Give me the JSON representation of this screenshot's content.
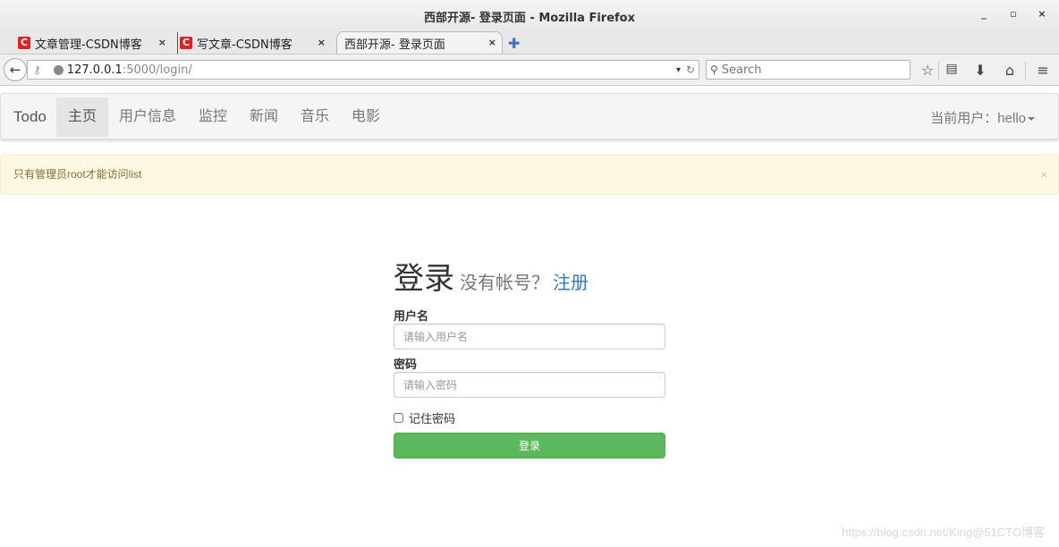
{
  "window": {
    "title": "西部开源- 登录页面 - Mozilla Firefox",
    "minimize": "_",
    "maximize": "▫",
    "close": "×"
  },
  "tabs": [
    {
      "label": "文章管理-CSDN博客",
      "favicon": "C",
      "close": "×"
    },
    {
      "label": "写文章-CSDN博客",
      "favicon": "C",
      "close": "×"
    },
    {
      "label": "西部开源- 登录页面",
      "close": "×",
      "active": true
    }
  ],
  "new_tab_icon": "✚",
  "toolbar": {
    "back_icon": "🡐",
    "url_host": "127.0.0.1",
    "url_rest": ":5000/login/",
    "search_placeholder": "Search",
    "icons": [
      "bookmark-star-icon",
      "reading-list-icon",
      "download-icon",
      "home-icon",
      "menu-icon"
    ]
  },
  "app": {
    "brand": "Todo",
    "nav": [
      {
        "label": "主页",
        "active": true
      },
      {
        "label": "用户信息"
      },
      {
        "label": "监控"
      },
      {
        "label": "新闻"
      },
      {
        "label": "音乐"
      },
      {
        "label": "电影"
      }
    ],
    "current_user": "当前用户：hello"
  },
  "alert": {
    "message": "只有管理员root才能访问list",
    "close": "×",
    "color": "#fcf8e3"
  },
  "login": {
    "title": "登录",
    "subtitle": "没有帐号？",
    "register_link": "注册",
    "username_label": "用户名",
    "username_placeholder": "请输入用户名",
    "password_label": "密码",
    "password_placeholder": "请输入密码",
    "remember_label": "记住密码",
    "remember_checked": false,
    "submit_label": "登录",
    "submit_color": "#5cb85c"
  },
  "watermark": "https://blog.csdn.net/King@51CTO博客"
}
